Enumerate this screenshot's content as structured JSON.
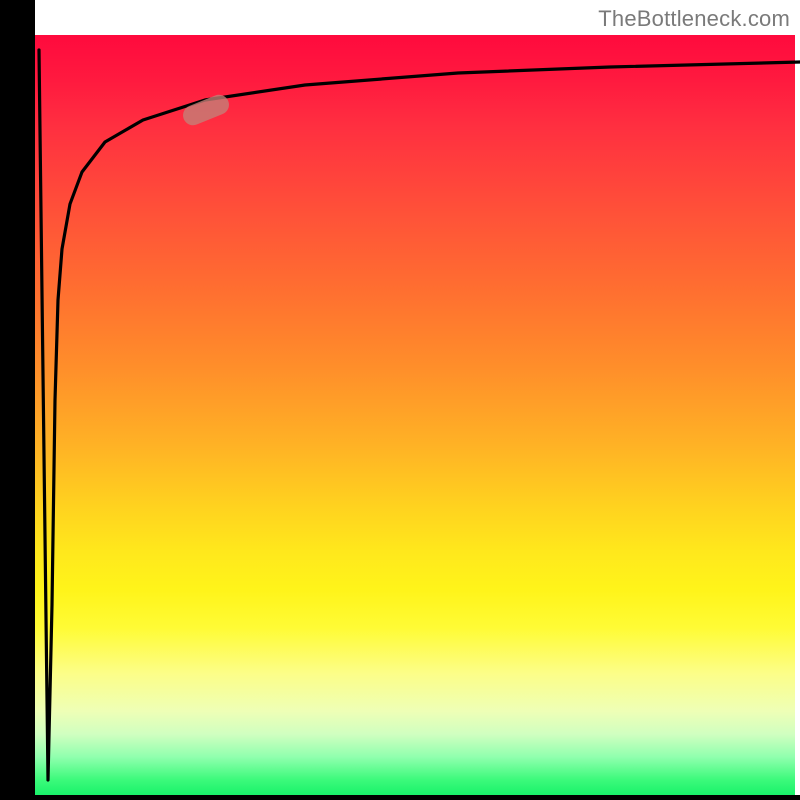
{
  "watermark": "TheBottleneck.com",
  "colors": {
    "axis": "#000000",
    "curve": "#000000",
    "marker": "#c38179",
    "gradient_top": "#ff0a3d",
    "gradient_bottom": "#19f26a"
  },
  "chart_data": {
    "type": "line",
    "title": "",
    "xlabel": "",
    "ylabel": "",
    "xlim": [
      0,
      100
    ],
    "ylim": [
      0,
      100
    ],
    "grid": false,
    "axes_visible": {
      "left": true,
      "bottom": true,
      "ticks": false
    },
    "background": "vertical-gradient red→orange→yellow→green (top→bottom)",
    "series": [
      {
        "name": "bottleneck-curve",
        "x": [
          0.5,
          1.5,
          2.0,
          2.5,
          3.0,
          3.5,
          4.5,
          6.0,
          9.0,
          14.0,
          22.0,
          35.0,
          55.0,
          75.0,
          100.0
        ],
        "y": [
          98,
          2,
          25,
          52,
          65,
          72,
          78,
          82,
          86,
          89,
          91.5,
          93.5,
          95,
          95.8,
          96.5
        ]
      }
    ],
    "marker": {
      "series": "bottleneck-curve",
      "x": 22,
      "y": 91.5,
      "shape": "rounded-rect",
      "angle_deg": -34
    },
    "notes": "The black curve starts near the top-left, dives sharply to near the bottom at x≈1.5, then rises steeply and asymptotically approaches ~96% toward the right edge. A single soft salmon marker highlights the point near x≈22."
  }
}
